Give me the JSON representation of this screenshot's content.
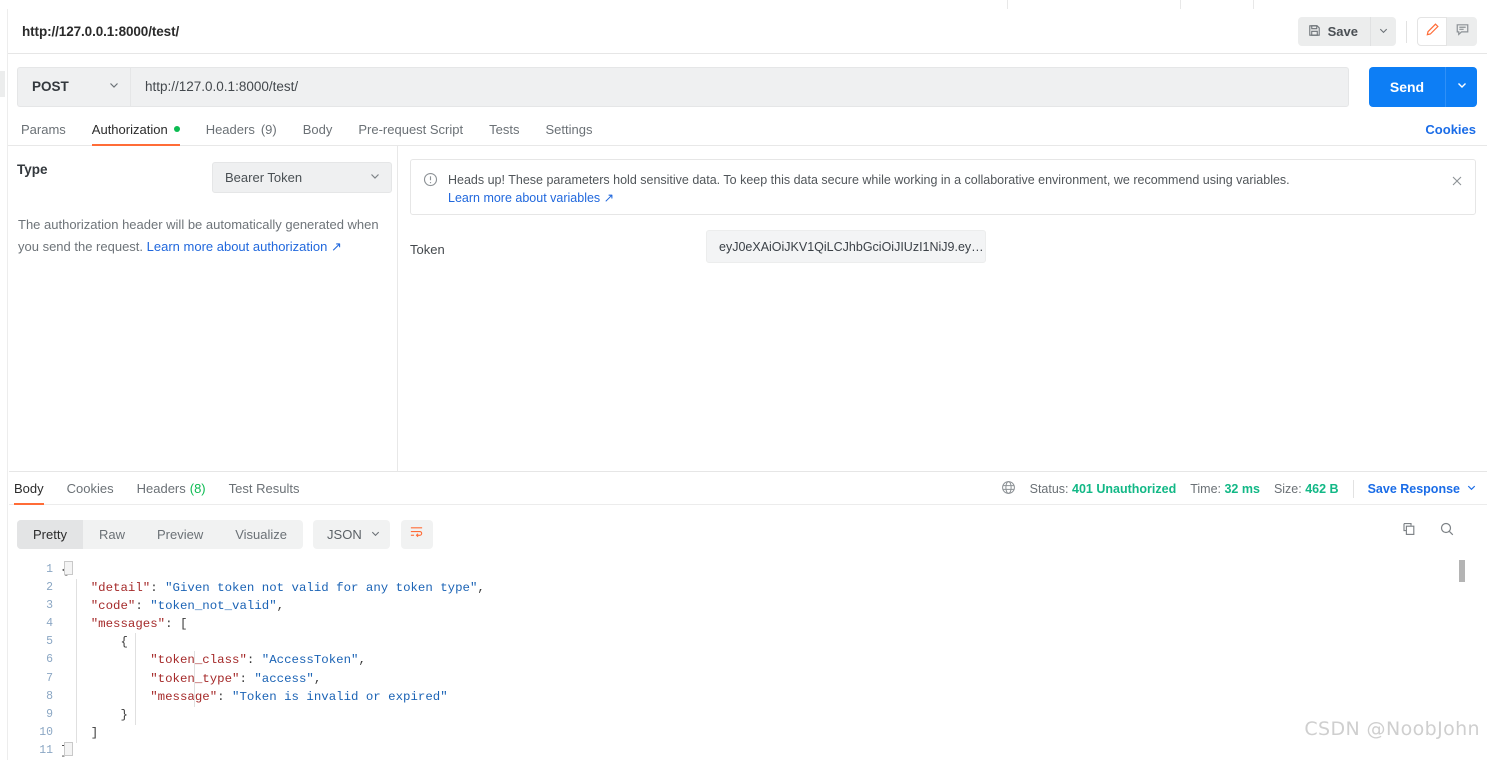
{
  "window": {
    "breadcrumb": "http://127.0.0.1:8000/test/"
  },
  "toolbar": {
    "save_label": "Save",
    "save_icon": "floppy-disk-icon",
    "save_caret_icon": "chevron-down-icon",
    "edit_icon": "pencil-icon",
    "comment_icon": "comment-icon",
    "accent_color": "#ff6c37"
  },
  "request": {
    "method": "POST",
    "method_caret_icon": "chevron-down-icon",
    "url": "http://127.0.0.1:8000/test/",
    "send_label": "Send",
    "send_caret_icon": "chevron-down-icon",
    "send_color": "#0d7ef5",
    "tabs": [
      {
        "label": "Params",
        "active": false,
        "dot": false,
        "count": ""
      },
      {
        "label": "Authorization",
        "active": true,
        "dot": true,
        "count": ""
      },
      {
        "label": "Headers",
        "active": false,
        "dot": false,
        "count": "(9)"
      },
      {
        "label": "Body",
        "active": false,
        "dot": false,
        "count": ""
      },
      {
        "label": "Pre-request Script",
        "active": false,
        "dot": false,
        "count": ""
      },
      {
        "label": "Tests",
        "active": false,
        "dot": false,
        "count": ""
      },
      {
        "label": "Settings",
        "active": false,
        "dot": false,
        "count": ""
      }
    ],
    "cookies_link": "Cookies"
  },
  "auth": {
    "type_label": "Type",
    "type_value": "Bearer Token",
    "type_caret_icon": "chevron-down-icon",
    "note_text": "The authorization header will be automatically generated when you send the request. ",
    "note_link": "Learn more about authorization",
    "note_link_icon": "external-link-icon",
    "token_label": "Token",
    "token_value": "eyJ0eXAiOiJKV1QiLCJhbGciOiJIUzI1NiJ9.ey…",
    "token_placeholder": "Token"
  },
  "banner": {
    "info_icon": "info-circle-icon",
    "text": "Heads up! These parameters hold sensitive data. To keep this data secure while working in a collaborative environment, we recommend using variables.",
    "link": "Learn more about variables",
    "link_icon": "external-link-icon",
    "close_icon": "close-icon"
  },
  "response": {
    "tabs": [
      {
        "label": "Body",
        "active": true,
        "count": ""
      },
      {
        "label": "Cookies",
        "active": false,
        "count": ""
      },
      {
        "label": "Headers",
        "active": false,
        "count": "(8)"
      },
      {
        "label": "Test Results",
        "active": false,
        "count": ""
      }
    ],
    "globe_icon": "globe-icon",
    "status_label": "Status:",
    "status_value": "401 Unauthorized",
    "time_label": "Time:",
    "time_value": "32 ms",
    "size_label": "Size:",
    "size_value": "462 B",
    "save_response_label": "Save Response",
    "save_response_caret_icon": "chevron-down-icon",
    "status_color": "#12b886",
    "format_tabs": [
      {
        "label": "Pretty",
        "active": true
      },
      {
        "label": "Raw",
        "active": false
      },
      {
        "label": "Preview",
        "active": false
      },
      {
        "label": "Visualize",
        "active": false
      }
    ],
    "language": "JSON",
    "language_caret_icon": "chevron-down-icon",
    "wrap_icon": "wrap-lines-icon",
    "copy_icon": "copy-icon",
    "search_icon": "search-icon",
    "line_numbers": [
      "1",
      "2",
      "3",
      "4",
      "5",
      "6",
      "7",
      "8",
      "9",
      "10",
      "11"
    ],
    "body_lines": [
      [
        {
          "t": "p",
          "v": "{"
        }
      ],
      [
        {
          "t": "p",
          "v": "    "
        },
        {
          "t": "k",
          "v": "\"detail\""
        },
        {
          "t": "p",
          "v": ": "
        },
        {
          "t": "s",
          "v": "\"Given token not valid for any token type\""
        },
        {
          "t": "p",
          "v": ","
        }
      ],
      [
        {
          "t": "p",
          "v": "    "
        },
        {
          "t": "k",
          "v": "\"code\""
        },
        {
          "t": "p",
          "v": ": "
        },
        {
          "t": "s",
          "v": "\"token_not_valid\""
        },
        {
          "t": "p",
          "v": ","
        }
      ],
      [
        {
          "t": "p",
          "v": "    "
        },
        {
          "t": "k",
          "v": "\"messages\""
        },
        {
          "t": "p",
          "v": ": ["
        }
      ],
      [
        {
          "t": "p",
          "v": "        {"
        }
      ],
      [
        {
          "t": "p",
          "v": "            "
        },
        {
          "t": "k",
          "v": "\"token_class\""
        },
        {
          "t": "p",
          "v": ": "
        },
        {
          "t": "s",
          "v": "\"AccessToken\""
        },
        {
          "t": "p",
          "v": ","
        }
      ],
      [
        {
          "t": "p",
          "v": "            "
        },
        {
          "t": "k",
          "v": "\"token_type\""
        },
        {
          "t": "p",
          "v": ": "
        },
        {
          "t": "s",
          "v": "\"access\""
        },
        {
          "t": "p",
          "v": ","
        }
      ],
      [
        {
          "t": "p",
          "v": "            "
        },
        {
          "t": "k",
          "v": "\"message\""
        },
        {
          "t": "p",
          "v": ": "
        },
        {
          "t": "s",
          "v": "\"Token is invalid or expired\""
        }
      ],
      [
        {
          "t": "p",
          "v": "        }"
        }
      ],
      [
        {
          "t": "p",
          "v": "    ]"
        }
      ],
      [
        {
          "t": "p",
          "v": "}"
        }
      ]
    ]
  },
  "watermark": "CSDN @NoobJohn"
}
